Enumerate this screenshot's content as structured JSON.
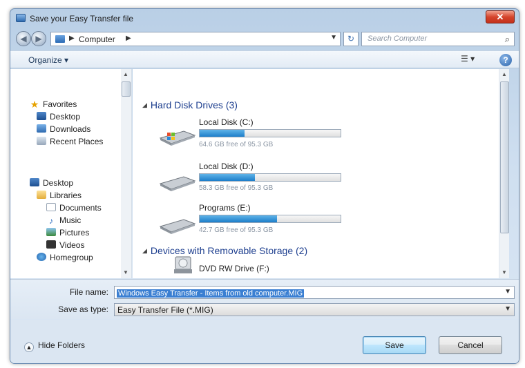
{
  "window": {
    "title": "Save your Easy Transfer file",
    "close_glyph": "✕"
  },
  "address": {
    "back_glyph": "◀",
    "forward_glyph": "▶",
    "separator": "▶",
    "path": "Computer",
    "refresh_glyph": "↻",
    "search_placeholder": "Search Computer",
    "search_icon": "search-icon"
  },
  "toolbar": {
    "organize_label": "Organize ▾",
    "view_glyph": "☰ ▾",
    "help_glyph": "?"
  },
  "nav": {
    "items": [
      {
        "label": "Favorites",
        "icon": "star-icon"
      },
      {
        "label": "Desktop",
        "icon": "desktop-icon"
      },
      {
        "label": "Downloads",
        "icon": "downloads-icon"
      },
      {
        "label": "Recent Places",
        "icon": "recent-places-icon"
      },
      {
        "label": "Desktop",
        "icon": "desktop-icon"
      },
      {
        "label": "Libraries",
        "icon": "libraries-icon"
      },
      {
        "label": "Documents",
        "icon": "documents-icon"
      },
      {
        "label": "Music",
        "icon": "music-icon"
      },
      {
        "label": "Pictures",
        "icon": "pictures-icon"
      },
      {
        "label": "Videos",
        "icon": "videos-icon"
      },
      {
        "label": "Homegroup",
        "icon": "homegroup-icon"
      }
    ]
  },
  "content": {
    "hard_disk_header": "Hard Disk Drives (3)",
    "removable_header": "Devices with Removable Storage (2)",
    "drives": [
      {
        "name": "Local Disk (C:)",
        "free": "64.6 GB free of 95.3 GB",
        "used_fraction": 0.32
      },
      {
        "name": "Local Disk (D:)",
        "free": "58.3 GB free of 95.3 GB",
        "used_fraction": 0.39
      },
      {
        "name": "Programs (E:)",
        "free": "42.7 GB free of 95.3 GB",
        "used_fraction": 0.55
      }
    ],
    "dvd": {
      "name": "DVD RW Drive (F:)"
    }
  },
  "fields": {
    "file_name_label": "File name:",
    "file_name_value": "Windows Easy Transfer - Items from old computer.MIG",
    "save_type_label": "Save as type:",
    "save_type_value": "Easy Transfer File (*.MIG)"
  },
  "footer": {
    "hide_folders_label": "Hide Folders",
    "save_label": "Save",
    "cancel_label": "Cancel"
  },
  "colors": {
    "accent": "#1e7ec9",
    "selection": "#3a7fd2",
    "header_text": "#1e3f8f"
  }
}
